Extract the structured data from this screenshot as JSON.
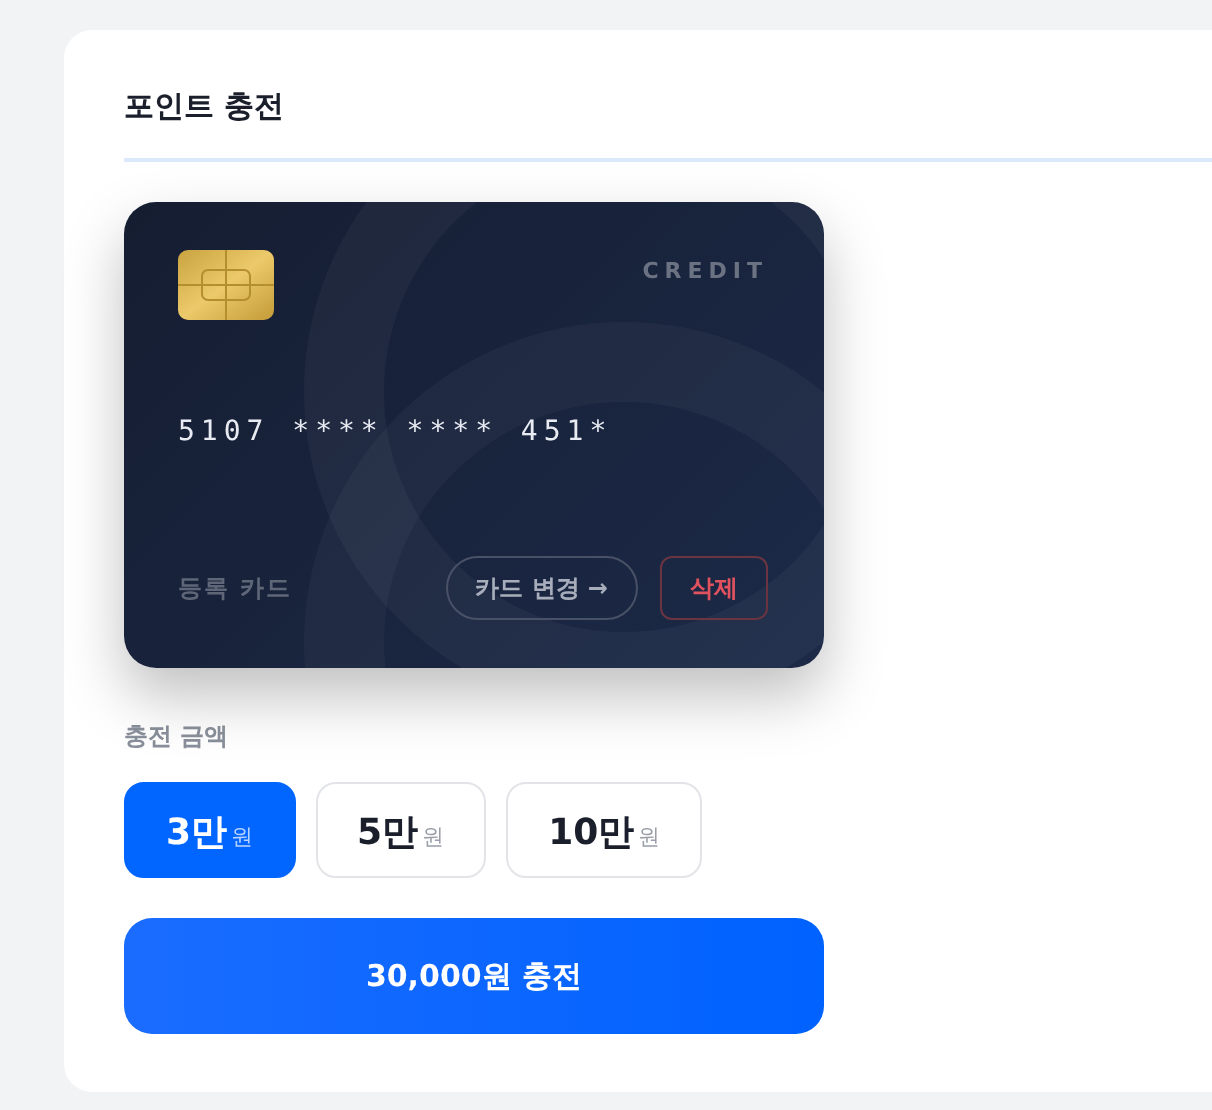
{
  "panel": {
    "title": "포인트 충전"
  },
  "card": {
    "type": "CREDIT",
    "number": "5107 **** **** 451*",
    "label": "등록 카드",
    "buttons": [
      {
        "label": "카드 변경 →",
        "kind": "change"
      },
      {
        "label": "삭제",
        "kind": "delete"
      }
    ]
  },
  "amount": {
    "label": "충전 금액",
    "options": [
      {
        "value": "3만",
        "unit": "원",
        "selected": true
      },
      {
        "value": "5만",
        "unit": "원",
        "selected": false
      },
      {
        "value": "10만",
        "unit": "원",
        "selected": false
      }
    ]
  },
  "submit": {
    "label": "30,000원 충전"
  }
}
